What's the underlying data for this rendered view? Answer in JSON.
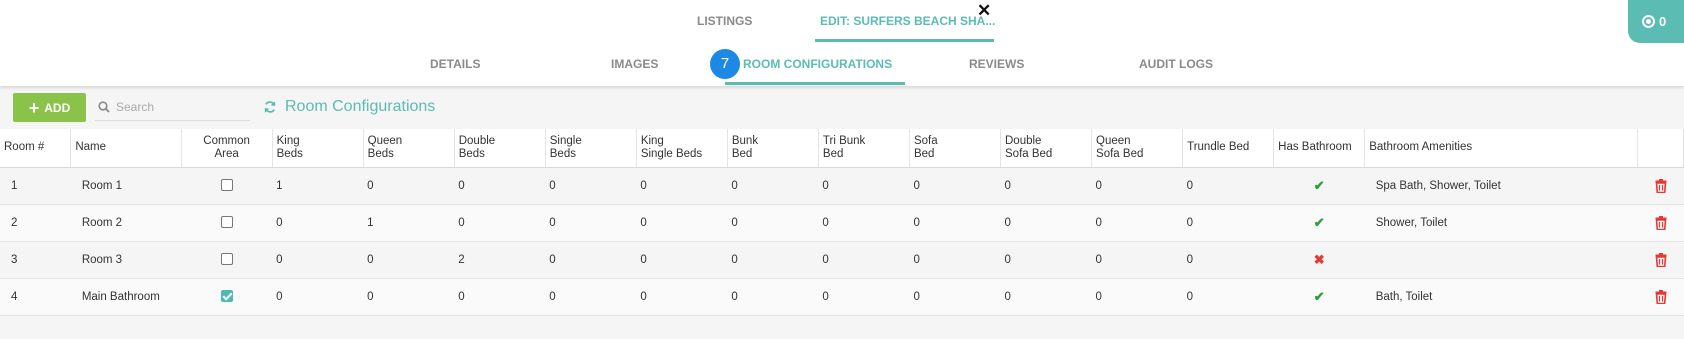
{
  "top_tabs": [
    {
      "label": "LISTINGS"
    },
    {
      "label": "EDIT: SURFERS BEACH SHA..."
    }
  ],
  "sub_tabs": [
    {
      "label": "DETAILS"
    },
    {
      "label": "IMAGES"
    },
    {
      "label": "ROOM CONFIGURATIONS"
    },
    {
      "label": "REVIEWS"
    },
    {
      "label": "AUDIT LOGS"
    }
  ],
  "step_badge": "7",
  "corner_count": "0",
  "toolbar": {
    "add_label": "ADD",
    "search_placeholder": "Search",
    "section_title": "Room Configurations"
  },
  "table": {
    "headers": [
      {
        "l1": "Room #",
        "l2": ""
      },
      {
        "l1": "Name",
        "l2": ""
      },
      {
        "l1": "Common",
        "l2": "Area"
      },
      {
        "l1": "King",
        "l2": "Beds"
      },
      {
        "l1": "Queen",
        "l2": "Beds"
      },
      {
        "l1": "Double",
        "l2": "Beds"
      },
      {
        "l1": "Single",
        "l2": "Beds"
      },
      {
        "l1": "King",
        "l2": "Single Beds"
      },
      {
        "l1": "Bunk",
        "l2": "Bed"
      },
      {
        "l1": "Tri Bunk",
        "l2": "Bed"
      },
      {
        "l1": "Sofa",
        "l2": "Bed"
      },
      {
        "l1": "Double",
        "l2": "Sofa Bed"
      },
      {
        "l1": "Queen",
        "l2": "Sofa Bed"
      },
      {
        "l1": "Trundle Bed",
        "l2": ""
      },
      {
        "l1": "Has Bathroom",
        "l2": ""
      },
      {
        "l1": "Bathroom Amenities",
        "l2": ""
      },
      {
        "l1": "",
        "l2": ""
      }
    ],
    "rows": [
      {
        "num": "1",
        "name": "Room 1",
        "common": false,
        "king": "1",
        "queen": "0",
        "double": "0",
        "single": "0",
        "king_single": "0",
        "bunk": "0",
        "tri_bunk": "0",
        "sofa": "0",
        "double_sofa": "0",
        "queen_sofa": "0",
        "trundle": "0",
        "has_bathroom": true,
        "amenities": "Spa Bath, Shower, Toilet"
      },
      {
        "num": "2",
        "name": "Room 2",
        "common": false,
        "king": "0",
        "queen": "1",
        "double": "0",
        "single": "0",
        "king_single": "0",
        "bunk": "0",
        "tri_bunk": "0",
        "sofa": "0",
        "double_sofa": "0",
        "queen_sofa": "0",
        "trundle": "0",
        "has_bathroom": true,
        "amenities": "Shower, Toilet"
      },
      {
        "num": "3",
        "name": "Room 3",
        "common": false,
        "king": "0",
        "queen": "0",
        "double": "2",
        "single": "0",
        "king_single": "0",
        "bunk": "0",
        "tri_bunk": "0",
        "sofa": "0",
        "double_sofa": "0",
        "queen_sofa": "0",
        "trundle": "0",
        "has_bathroom": false,
        "amenities": ""
      },
      {
        "num": "4",
        "name": "Main Bathroom",
        "common": true,
        "king": "0",
        "queen": "0",
        "double": "0",
        "single": "0",
        "king_single": "0",
        "bunk": "0",
        "tri_bunk": "0",
        "sofa": "0",
        "double_sofa": "0",
        "queen_sofa": "0",
        "trundle": "0",
        "has_bathroom": true,
        "amenities": "Bath, Toilet"
      }
    ]
  },
  "colors": {
    "accent": "#5bbcb4",
    "add_button": "#8bc34a",
    "badge": "#1e88e5",
    "delete": "#e53935",
    "check": "#2e9e3a"
  }
}
